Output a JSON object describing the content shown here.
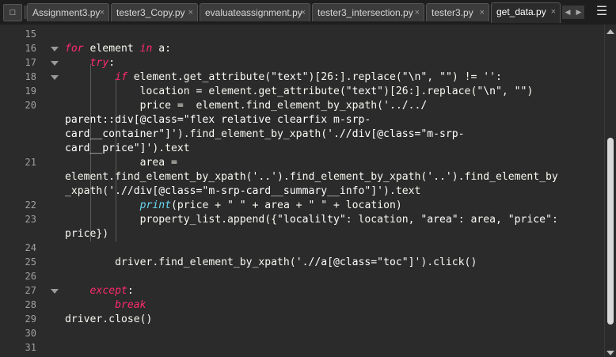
{
  "tabs": [
    {
      "label": "Assignment3.py",
      "active": false
    },
    {
      "label": "tester3_Copy.py",
      "active": false
    },
    {
      "label": "evaluateassignment.py",
      "active": false
    },
    {
      "label": "tester3_intersection.py",
      "active": false
    },
    {
      "label": "tester3.py",
      "active": false
    },
    {
      "label": "get_data.py",
      "active": true
    }
  ],
  "close_glyph": "×",
  "line_numbers": [
    "15",
    "16",
    "17",
    "18",
    "19",
    "20",
    "21",
    "22",
    "23",
    "24",
    "25",
    "26",
    "27",
    "28",
    "29",
    "30",
    "31"
  ],
  "code": {
    "l16": {
      "kw1": "for",
      "t1": " element ",
      "kw2": "in",
      "t2": " a:"
    },
    "l17": {
      "kw": "try",
      "t": ":"
    },
    "l18": {
      "kw": "if",
      "t1": " element.get_attribute(",
      "s1": "\"text\"",
      "t2": ")[26:].replace(",
      "s2": "\"\\n\"",
      "t3": ", ",
      "s3": "\"\"",
      "t4": ") != '':"
    },
    "l19": {
      "t1": "location = element.get_attribute(",
      "s1": "\"text\"",
      "t2": ")[26:].replace(",
      "s2": "\"\\n\"",
      "t3": ", ",
      "s3": "\"\"",
      "t4": ")"
    },
    "l20a": {
      "t1": "price =  element.find_element_by_xpath(",
      "s1": "'../../"
    },
    "l20b": {
      "s1": "parent::div[@class=\"flex relative clearfix m-srp-"
    },
    "l20c": {
      "s1": "card__container\"]'",
      "t1": ").find_element_by_xpath(",
      "s2": "'.//div[@class=\"m-srp-"
    },
    "l20d": {
      "s1": "card__price\"]'",
      "t1": ").text"
    },
    "l21a": {
      "t1": "area ="
    },
    "l21b": {
      "t1": "element.find_element_by_xpath(",
      "s1": "'..'",
      "t2": ").find_element_by_xpath(",
      "s2": "'..'",
      "t3": ").find_element_by"
    },
    "l21c": {
      "t1": "_xpath(",
      "s1": "'.//div[@class=\"m-srp-card__summary__info\"]'",
      "t2": ").text"
    },
    "l22": {
      "fn": "print",
      "t1": "(price + ",
      "s1": "\" \"",
      "t2": " + area + ",
      "s2": "\" \"",
      "t3": " + location)"
    },
    "l23a": {
      "t1": "property_list.append({",
      "s1": "\"localilty\"",
      "t2": ": location, ",
      "s2": "\"area\"",
      "t3": ": area, ",
      "s3": "\"price\"",
      "t4": ":"
    },
    "l23b": {
      "t1": "price})"
    },
    "l25": {
      "t1": "driver.find_element_by_xpath(",
      "s1": "'.//a[@class=\"toc\"]'",
      "t2": ").click()"
    },
    "l27": {
      "kw": "except",
      "t": ":"
    },
    "l28": {
      "kw": "break"
    },
    "l29": {
      "t1": "driver.close()"
    }
  }
}
